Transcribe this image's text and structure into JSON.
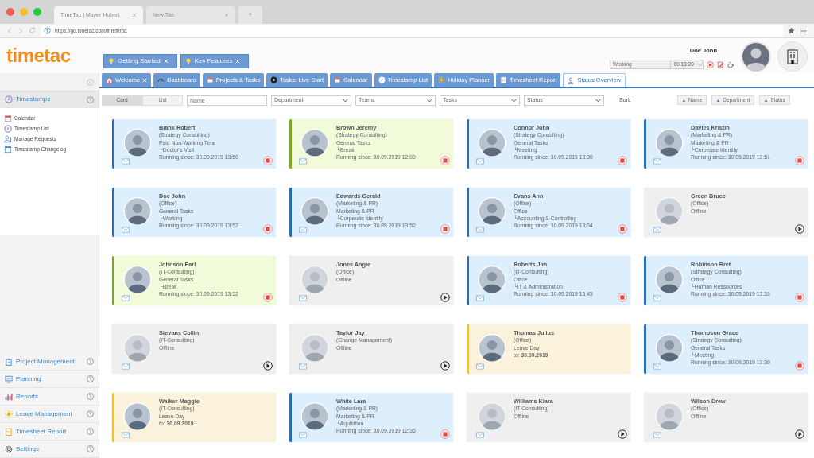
{
  "browser": {
    "tabs": [
      {
        "label": "TimeTac | Mayer Hubert",
        "selected": true
      },
      {
        "label": "New Tab",
        "selected": false
      }
    ],
    "new_tab": "+",
    "url": "https://go.timetac.com/ihrefirma"
  },
  "header": {
    "logo": "timetac",
    "quick_links": [
      {
        "label": "Getting Started"
      },
      {
        "label": "Key Features"
      }
    ],
    "user_name": "Doe John",
    "status_field": "Working",
    "timer": "00:13:20"
  },
  "app_tabs": [
    {
      "label": "Welcome",
      "closable": true,
      "selected": false
    },
    {
      "label": "Dashboard",
      "closable": false,
      "selected": false
    },
    {
      "label": "Projects & Tasks",
      "closable": false,
      "selected": false
    },
    {
      "label": "Tasks: Live Start",
      "closable": false,
      "selected": false
    },
    {
      "label": "Calendar",
      "closable": false,
      "selected": false
    },
    {
      "label": "Timestamp List",
      "closable": false,
      "selected": false
    },
    {
      "label": "Holiday Planner",
      "closable": false,
      "selected": false
    },
    {
      "label": "Timesheet Report",
      "closable": false,
      "selected": false
    },
    {
      "label": "Status Overview",
      "closable": false,
      "selected": true
    }
  ],
  "sidebar": {
    "sections": [
      {
        "label": "Timestamps",
        "help": "?",
        "expanded": true,
        "children": [
          {
            "label": "Calendar"
          },
          {
            "label": "Timestamp List"
          },
          {
            "label": "Manage Requests"
          },
          {
            "label": "Timestamp Changelog"
          }
        ]
      },
      {
        "label": "Project Management",
        "help": "?",
        "expanded": false
      },
      {
        "label": "Planning",
        "help": "?",
        "expanded": false
      },
      {
        "label": "Reports",
        "help": "?",
        "expanded": false
      },
      {
        "label": "Leave Management",
        "help": "?",
        "expanded": false
      },
      {
        "label": "Timesheet Report",
        "help": "?",
        "expanded": false
      },
      {
        "label": "Settings",
        "help": "?",
        "expanded": false
      }
    ]
  },
  "toolbar": {
    "views": [
      {
        "label": "Card",
        "selected": true
      },
      {
        "label": "List",
        "selected": false
      }
    ],
    "filters": [
      {
        "placeholder": "Name",
        "kind": "text"
      },
      {
        "placeholder": "Department",
        "kind": "select"
      },
      {
        "placeholder": "Teams",
        "kind": "select"
      },
      {
        "placeholder": "Tasks",
        "kind": "select"
      },
      {
        "placeholder": "Status",
        "kind": "select"
      }
    ],
    "sort_label": "Sort:",
    "sort_buttons": [
      "Name",
      "Department",
      "Status"
    ]
  },
  "employees": [
    {
      "name": "Blank Robert",
      "kind": "working",
      "lines": [
        "(Strategy Consulting)",
        "Paid Non-Working Time",
        "└Doctor's Visit",
        "Running since: 30.09.2019 13:50"
      ]
    },
    {
      "name": "Brown Jeremy",
      "kind": "break",
      "lines": [
        "(Strategy Consulting)",
        "General Tasks",
        "└Break",
        "Running since: 30.09.2019 12:00"
      ]
    },
    {
      "name": "Connor John",
      "kind": "working",
      "lines": [
        "(Strategy Consulting)",
        "General Tasks",
        "└Meeting",
        "Running since: 30.09.2019 13:30"
      ]
    },
    {
      "name": "Davies Kristin",
      "kind": "working",
      "lines": [
        "(Marketing & PR)",
        "Marketing & PR",
        "└Corperate Identity",
        "Running since: 30.09.2019 13:51"
      ]
    },
    {
      "name": "Doe John",
      "kind": "working",
      "lines": [
        "(Office)",
        "General Tasks",
        "└Working",
        "Running since: 30.09.2019 13:52"
      ]
    },
    {
      "name": "Edwards Gerald",
      "kind": "working",
      "lines": [
        "(Marketing & PR)",
        "Marketing & PR",
        "└Corperate Identity",
        "Running since: 30.09.2019 13:52"
      ]
    },
    {
      "name": "Evans Ann",
      "kind": "working",
      "lines": [
        "(Office)",
        "Office",
        "└Accounting & Controlling",
        "Running since: 30.09.2019 13:04"
      ]
    },
    {
      "name": "Green Bruce",
      "kind": "offline",
      "lines": [
        "(Office)",
        "Offline"
      ]
    },
    {
      "name": "Johnson Earl",
      "kind": "break",
      "lines": [
        "(IT-Consulting)",
        "General Tasks",
        "└Break",
        "Running since: 30.09.2019 13:52"
      ]
    },
    {
      "name": "Jones Angie",
      "kind": "offline",
      "lines": [
        "(Office)",
        "Offline"
      ]
    },
    {
      "name": "Roberts Jim",
      "kind": "working",
      "lines": [
        "(IT-Consulting)",
        "Office",
        "└IT & Administration",
        "Running since: 30.09.2019 13:45"
      ]
    },
    {
      "name": "Robinson Bret",
      "kind": "working",
      "lines": [
        "(Strategy Consulting)",
        "Office",
        "└Human Ressources",
        "Running since: 30.09.2019 13:53"
      ]
    },
    {
      "name": "Stevans Collin",
      "kind": "offline",
      "lines": [
        "(IT-Consulting)",
        "Offline"
      ]
    },
    {
      "name": "Taylor Jay",
      "kind": "offline",
      "lines": [
        "(Change Management)",
        "Offline"
      ]
    },
    {
      "name": "Thomas Julius",
      "kind": "leave",
      "lines": [
        "(Office)",
        "Leave Day",
        "to: **30.09.2019**"
      ]
    },
    {
      "name": "Thompson Grace",
      "kind": "working",
      "lines": [
        "(Strategy Consulting)",
        "General Tasks",
        "└Meeting",
        "Running since: 30.09.2019 13:30"
      ]
    },
    {
      "name": "Walker Maggie",
      "kind": "leave",
      "lines": [
        "(IT-Consulting)",
        "Leave Day",
        "to: **30.09.2019**"
      ]
    },
    {
      "name": "White Lara",
      "kind": "working",
      "lines": [
        "(Marketing & PR)",
        "Marketing & PR",
        "└Aquisition",
        "Running since: 30.09.2019 12:36"
      ]
    },
    {
      "name": "Williams Kiara",
      "kind": "offline",
      "lines": [
        "(IT-Consulting)",
        "Offline"
      ]
    },
    {
      "name": "Wilson Drew",
      "kind": "offline",
      "lines": [
        "(Office)",
        "Offline"
      ]
    }
  ]
}
